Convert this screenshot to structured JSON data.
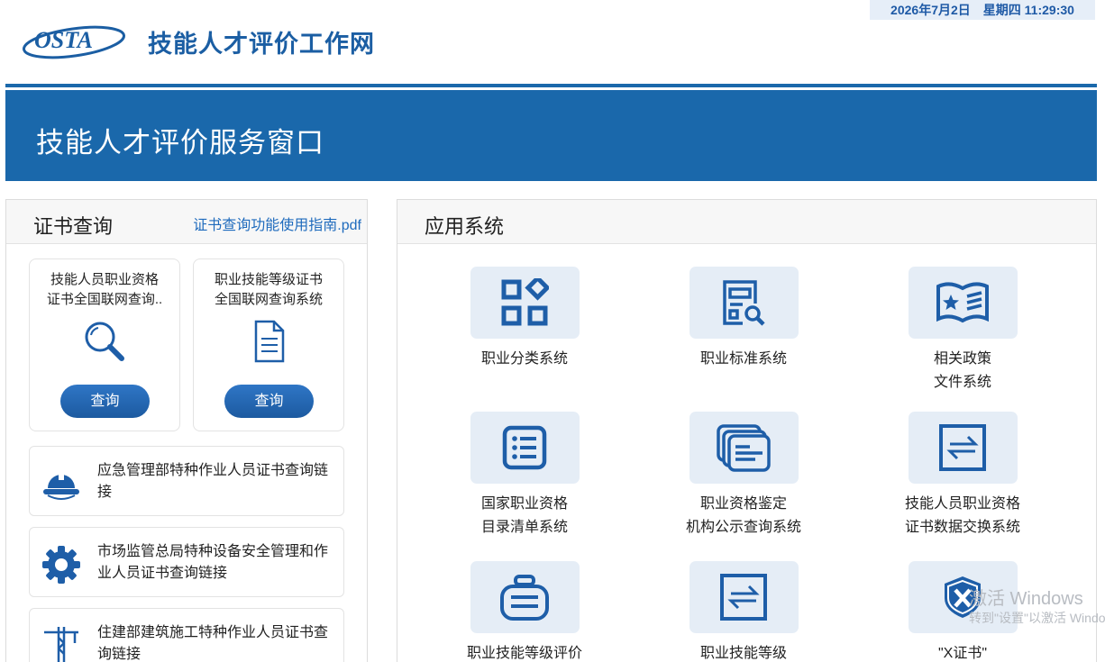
{
  "header": {
    "date": "2026年7月2日",
    "weekday_time": "星期四 11:29:30",
    "logo_text": "OSTA",
    "site_title": "技能人才评价工作网"
  },
  "banner": {
    "title": "技能人才评价服务窗口"
  },
  "cert_query": {
    "title": "证书查询",
    "guide_link": "证书查询功能使用指南.pdf",
    "cards": [
      {
        "line1": "技能人员职业资格",
        "line2": "证书全国联网查询..",
        "button": "查询",
        "icon": "search-icon"
      },
      {
        "line1": "职业技能等级证书",
        "line2": "全国联网查询系统",
        "button": "查询",
        "icon": "document-icon"
      }
    ],
    "links": [
      {
        "text": "应急管理部特种作业人员证书查询链接",
        "icon": "hard-hat-icon"
      },
      {
        "text": "市场监管总局特种设备安全管理和作业人员证书查询链接",
        "icon": "gear-icon"
      },
      {
        "text": "住建部建筑施工特种作业人员证书查询链接",
        "icon": "tower-crane-icon"
      }
    ]
  },
  "app_systems": {
    "title": "应用系统",
    "items": [
      {
        "line1": "职业分类系统",
        "line2": "",
        "icon": "category-grid-icon"
      },
      {
        "line1": "职业标准系统",
        "line2": "",
        "icon": "standard-search-icon"
      },
      {
        "line1": "相关政策",
        "line2": "文件系统",
        "icon": "policy-book-icon"
      },
      {
        "line1": "国家职业资格",
        "line2": "目录清单系统",
        "icon": "list-icon"
      },
      {
        "line1": "职业资格鉴定",
        "line2": "机构公示查询系统",
        "icon": "stacked-docs-icon"
      },
      {
        "line1": "技能人员职业资格",
        "line2": "证书数据交换系统",
        "icon": "exchange-icon"
      },
      {
        "line1": "职业技能等级评价",
        "line2": "",
        "icon": "hanging-sign-icon"
      },
      {
        "line1": "职业技能等级",
        "line2": "",
        "icon": "exchange-icon"
      },
      {
        "line1": "\"X证书\"",
        "line2": "",
        "icon": "shield-x-icon"
      }
    ]
  },
  "watermark": {
    "line1": "激活 Windows",
    "line2": "转到\"设置\"以激活 Windows。"
  },
  "colors": {
    "primary": "#1a68ab",
    "icon_blue": "#1e5ea8",
    "tile_bg": "#e5edf6",
    "link": "#1f6bbd"
  }
}
